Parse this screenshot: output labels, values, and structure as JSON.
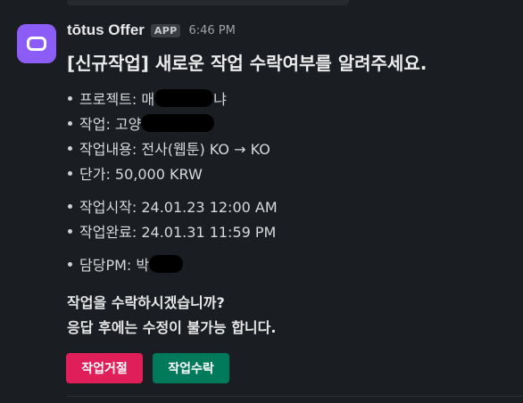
{
  "message": {
    "sender": "tōtus Offer",
    "app_badge": "APP",
    "timestamp": "6:46 PM",
    "title": "[신규작업] 새로운 작업 수락여부를 알려주세요.",
    "fields": {
      "project_label": "프로젝트: 매",
      "project_suffix": "냐",
      "task_label": "작업: 고양",
      "content": "작업내용: 전사(웹툰) KO → KO",
      "price": "단가: 50,000 KRW",
      "start": "작업시작: 24.01.23 12:00 AM",
      "end": "작업완료: 24.01.31 11:59 PM",
      "pm_label": "담당PM: 박"
    },
    "question_line1": "작업을 수락하시겠습니까?",
    "question_line2": "응답 후에는 수정이 불가능 합니다."
  },
  "actions": {
    "reject_label": "작업거절",
    "accept_label": "작업수락",
    "reject_color": "#e01e5a",
    "accept_color": "#007a5a"
  },
  "colors": {
    "background": "#1a1d21",
    "avatar": "#8b5cf6"
  }
}
